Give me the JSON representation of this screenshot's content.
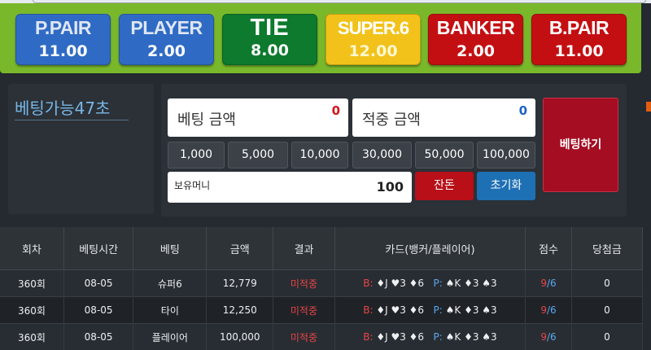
{
  "bet_buttons": [
    {
      "name": "P.PAIR",
      "odds": "11.00"
    },
    {
      "name": "PLAYER",
      "odds": "2.00"
    },
    {
      "name": "TIE",
      "odds": "8.00"
    },
    {
      "name": "SUPER.6",
      "odds": "12.00"
    },
    {
      "name": "BANKER",
      "odds": "2.00"
    },
    {
      "name": "B.PAIR",
      "odds": "11.00"
    }
  ],
  "timer": "베팅가능47초",
  "bet_amount": {
    "label": "베팅 금액",
    "value": "0"
  },
  "win_amount": {
    "label": "적중 금액",
    "value": "0"
  },
  "chips": [
    "1,000",
    "5,000",
    "10,000",
    "30,000",
    "50,000",
    "100,000"
  ],
  "money": {
    "label": "보유머니",
    "value": "100"
  },
  "buttons": {
    "change": "잔돈",
    "reset": "초기화",
    "place_bet": "베팅하기"
  },
  "table": {
    "headers": [
      "회차",
      "베팅시간",
      "베팅",
      "금액",
      "결과",
      "카드(뱅커/플레이어)",
      "점수",
      "당첨금"
    ],
    "rows": [
      {
        "round": "360회",
        "time": "08-05",
        "bet": "슈퍼6",
        "amount": "12,779",
        "result": "미적중",
        "banker_label": "B:",
        "banker_cards": "♦J ♥3 ♦6",
        "player_label": "P:",
        "player_cards": "♠K ♦3 ♠3",
        "score_b": "9",
        "score_sep": "/",
        "score_p": "6",
        "prize": "0"
      },
      {
        "round": "360회",
        "time": "08-05",
        "bet": "타이",
        "amount": "12,250",
        "result": "미적중",
        "banker_label": "B:",
        "banker_cards": "♦J ♥3 ♦6",
        "player_label": "P:",
        "player_cards": "♠K ♦3 ♠3",
        "score_b": "9",
        "score_sep": "/",
        "score_p": "6",
        "prize": "0"
      },
      {
        "round": "360회",
        "time": "08-05",
        "bet": "플레이어",
        "amount": "100,000",
        "result": "미적중",
        "banker_label": "B:",
        "banker_cards": "♦J ♥3 ♦6",
        "player_label": "P:",
        "player_cards": "♠K ♦3 ♠3",
        "score_b": "9",
        "score_sep": "/",
        "score_p": "6",
        "prize": "0"
      }
    ]
  }
}
